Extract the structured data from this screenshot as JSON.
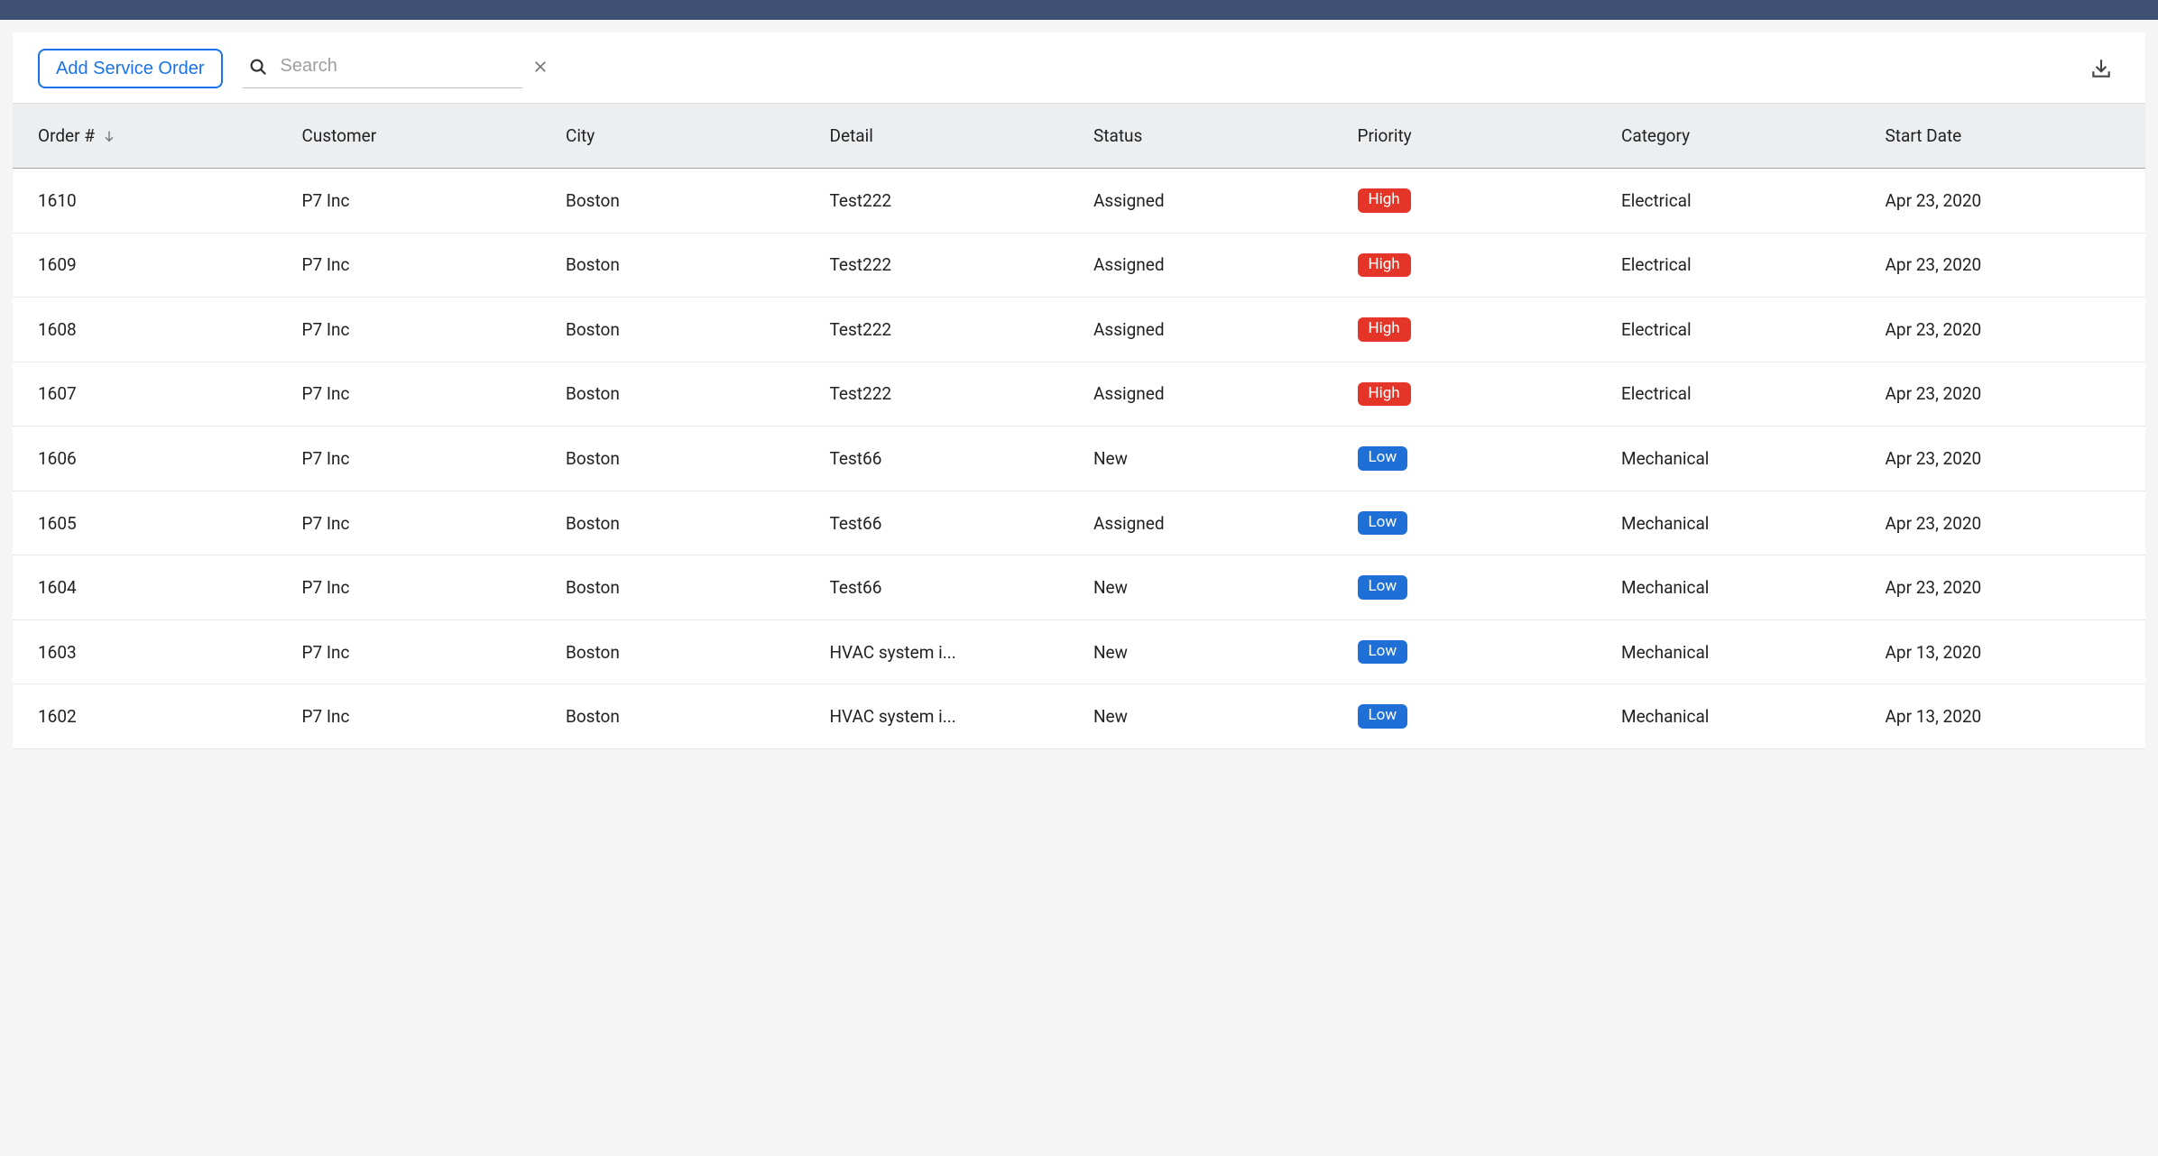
{
  "toolbar": {
    "add_label": "Add Service Order",
    "search_placeholder": "Search"
  },
  "columns": [
    {
      "key": "order",
      "label": "Order #",
      "sorted": "desc"
    },
    {
      "key": "customer",
      "label": "Customer"
    },
    {
      "key": "city",
      "label": "City"
    },
    {
      "key": "detail",
      "label": "Detail"
    },
    {
      "key": "status",
      "label": "Status"
    },
    {
      "key": "priority",
      "label": "Priority"
    },
    {
      "key": "category",
      "label": "Category"
    },
    {
      "key": "startdate",
      "label": "Start Date"
    }
  ],
  "priority_styles": {
    "High": "badge-high",
    "Low": "badge-low"
  },
  "rows": [
    {
      "order": "1610",
      "customer": "P7 Inc",
      "city": "Boston",
      "detail": "Test222",
      "status": "Assigned",
      "priority": "High",
      "category": "Electrical",
      "startdate": "Apr 23, 2020"
    },
    {
      "order": "1609",
      "customer": "P7 Inc",
      "city": "Boston",
      "detail": "Test222",
      "status": "Assigned",
      "priority": "High",
      "category": "Electrical",
      "startdate": "Apr 23, 2020"
    },
    {
      "order": "1608",
      "customer": "P7 Inc",
      "city": "Boston",
      "detail": "Test222",
      "status": "Assigned",
      "priority": "High",
      "category": "Electrical",
      "startdate": "Apr 23, 2020"
    },
    {
      "order": "1607",
      "customer": "P7 Inc",
      "city": "Boston",
      "detail": "Test222",
      "status": "Assigned",
      "priority": "High",
      "category": "Electrical",
      "startdate": "Apr 23, 2020"
    },
    {
      "order": "1606",
      "customer": "P7 Inc",
      "city": "Boston",
      "detail": "Test66",
      "status": "New",
      "priority": "Low",
      "category": "Mechanical",
      "startdate": "Apr 23, 2020"
    },
    {
      "order": "1605",
      "customer": "P7 Inc",
      "city": "Boston",
      "detail": "Test66",
      "status": "Assigned",
      "priority": "Low",
      "category": "Mechanical",
      "startdate": "Apr 23, 2020"
    },
    {
      "order": "1604",
      "customer": "P7 Inc",
      "city": "Boston",
      "detail": "Test66",
      "status": "New",
      "priority": "Low",
      "category": "Mechanical",
      "startdate": "Apr 23, 2020"
    },
    {
      "order": "1603",
      "customer": "P7 Inc",
      "city": "Boston",
      "detail": "HVAC system i...",
      "status": "New",
      "priority": "Low",
      "category": "Mechanical",
      "startdate": "Apr 13, 2020"
    },
    {
      "order": "1602",
      "customer": "P7 Inc",
      "city": "Boston",
      "detail": "HVAC system i...",
      "status": "New",
      "priority": "Low",
      "category": "Mechanical",
      "startdate": "Apr 13, 2020"
    }
  ]
}
